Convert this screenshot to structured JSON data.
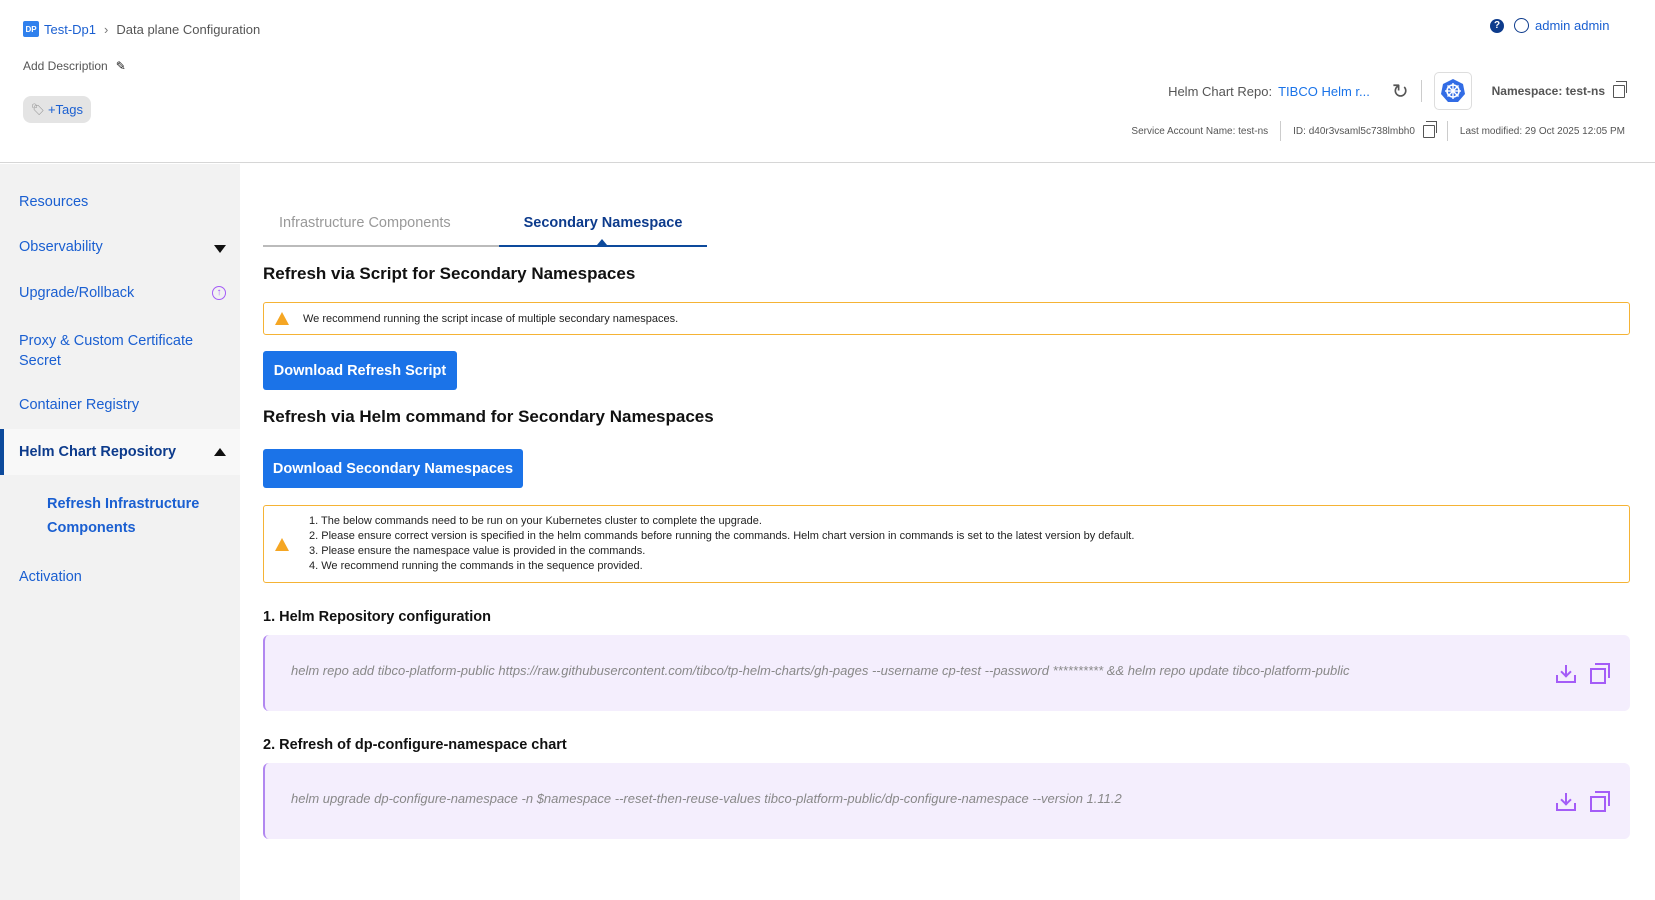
{
  "header": {
    "breadcrumb": {
      "badge": "DP",
      "dataplane": "Test-Dp1",
      "page": "Data plane Configuration"
    },
    "add_description": "Add Description",
    "tags_label": "+Tags",
    "help": "?",
    "user": "admin admin",
    "helm_repo_label": "Helm Chart Repo:",
    "helm_repo_value": "TIBCO Helm r...",
    "namespace": "Namespace: test-ns",
    "service_account": "Service Account Name: test-ns",
    "id": "ID: d40r3vsaml5c738lmbh0",
    "last_modified": "Last modified: 29 Oct 2025 12:05 PM"
  },
  "sidebar": {
    "items": [
      {
        "label": "Resources"
      },
      {
        "label": "Observability"
      },
      {
        "label": "Upgrade/Rollback"
      },
      {
        "label": "Proxy & Custom Certificate Secret"
      },
      {
        "label": "Container Registry"
      },
      {
        "label": "Helm Chart Repository"
      },
      {
        "label": "Refresh Infrastructure Components"
      },
      {
        "label": "Activation"
      }
    ]
  },
  "tabs": [
    {
      "label": "Infrastructure Components"
    },
    {
      "label": "Secondary Namespace"
    }
  ],
  "main": {
    "script_heading": "Refresh via Script for Secondary Namespaces",
    "script_warning": "We recommend running the script incase of multiple secondary namespaces.",
    "download_script": "Download Refresh Script",
    "helm_heading": "Refresh via Helm command for Secondary Namespaces",
    "download_namespaces": "Download Secondary Namespaces",
    "notes": [
      "1. The below commands need to be run on your Kubernetes cluster to complete the upgrade.",
      "2. Please ensure correct version is specified in the helm commands before running the commands. Helm chart version in commands is set to the latest version by default.",
      "3. Please ensure the namespace value is provided in the commands.",
      "4. We recommend running the commands in the sequence provided."
    ],
    "steps": [
      {
        "title": "1. Helm Repository configuration",
        "command": "helm repo add tibco-platform-public https://raw.githubusercontent.com/tibco/tp-helm-charts/gh-pages --username cp-test --password ********** && helm repo update tibco-platform-public"
      },
      {
        "title": "2. Refresh of dp-configure-namespace chart",
        "command": "helm upgrade dp-configure-namespace -n $namespace --reset-then-reuse-values tibco-platform-public/dp-configure-namespace --version 1.11.2"
      }
    ]
  }
}
